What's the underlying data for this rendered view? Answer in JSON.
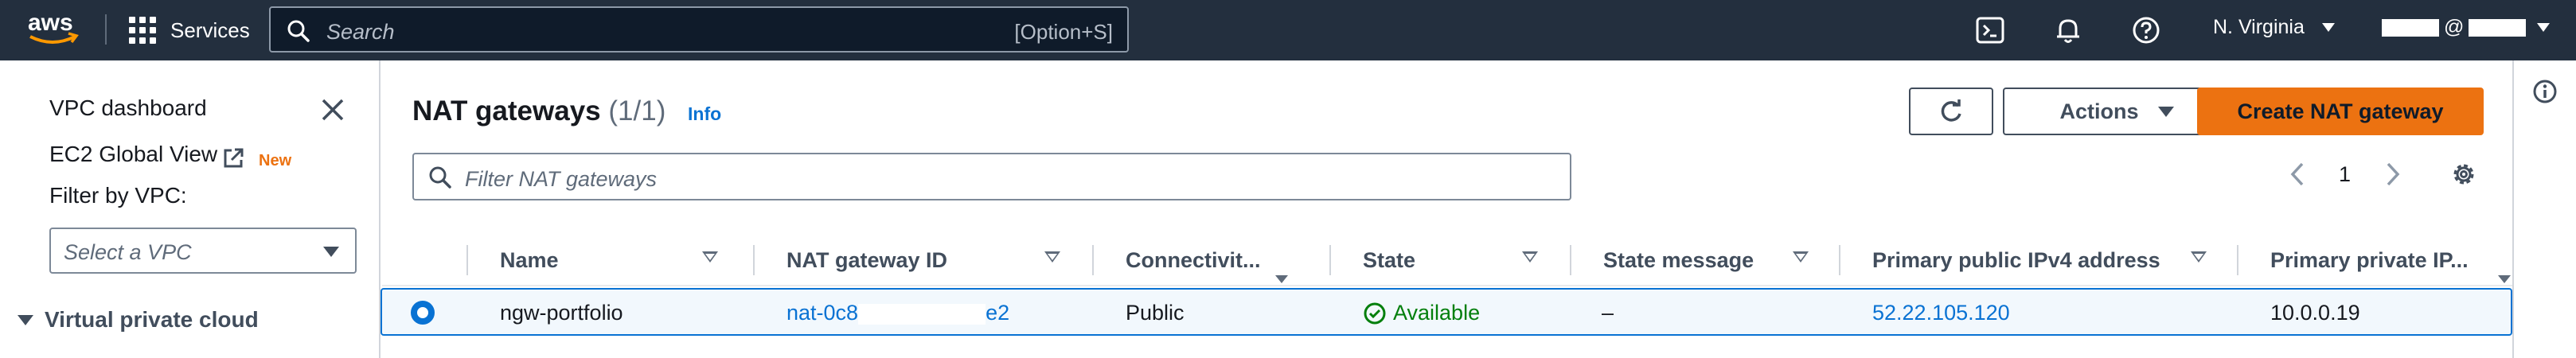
{
  "topnav": {
    "logo_text": "aws",
    "services_label": "Services",
    "search_placeholder": "Search",
    "search_shortcut": "[Option+S]",
    "region": "N. Virginia",
    "account_separator": "@"
  },
  "sidebar": {
    "dashboard_link": "VPC dashboard",
    "global_view_link": "EC2 Global View",
    "global_view_badge": "New",
    "filter_label": "Filter by VPC:",
    "vpc_select_placeholder": "Select a VPC",
    "section_title": "Virtual private cloud"
  },
  "main": {
    "title": "NAT gateways",
    "count": "(1/1)",
    "info_link": "Info",
    "actions_label": "Actions",
    "create_label": "Create NAT gateway",
    "filter_placeholder": "Filter NAT gateways",
    "current_page": "1"
  },
  "table": {
    "columns": [
      "Name",
      "NAT gateway ID",
      "Connectivit...",
      "State",
      "State message",
      "Primary public IPv4 address",
      "Primary private IP..."
    ],
    "rows": [
      {
        "name": "ngw-portfolio",
        "id_prefix": "nat-0c8",
        "id_suffix": "e2",
        "connectivity": "Public",
        "state": "Available",
        "state_message": "–",
        "public_ip": "52.22.105.120",
        "private_ip": "10.0.0.19",
        "selected": true
      }
    ]
  },
  "colors": {
    "nav_bg": "#232f3e",
    "accent_orange": "#ec7211",
    "link_blue": "#0972d3",
    "success_green": "#037f0c"
  },
  "icons": [
    "grid-icon",
    "search-icon",
    "cloudshell-icon",
    "bell-icon",
    "help-icon",
    "close-icon",
    "external-link-icon",
    "refresh-icon",
    "chevron-left-icon",
    "chevron-right-icon",
    "settings-icon",
    "status-check-icon",
    "info-icon"
  ]
}
